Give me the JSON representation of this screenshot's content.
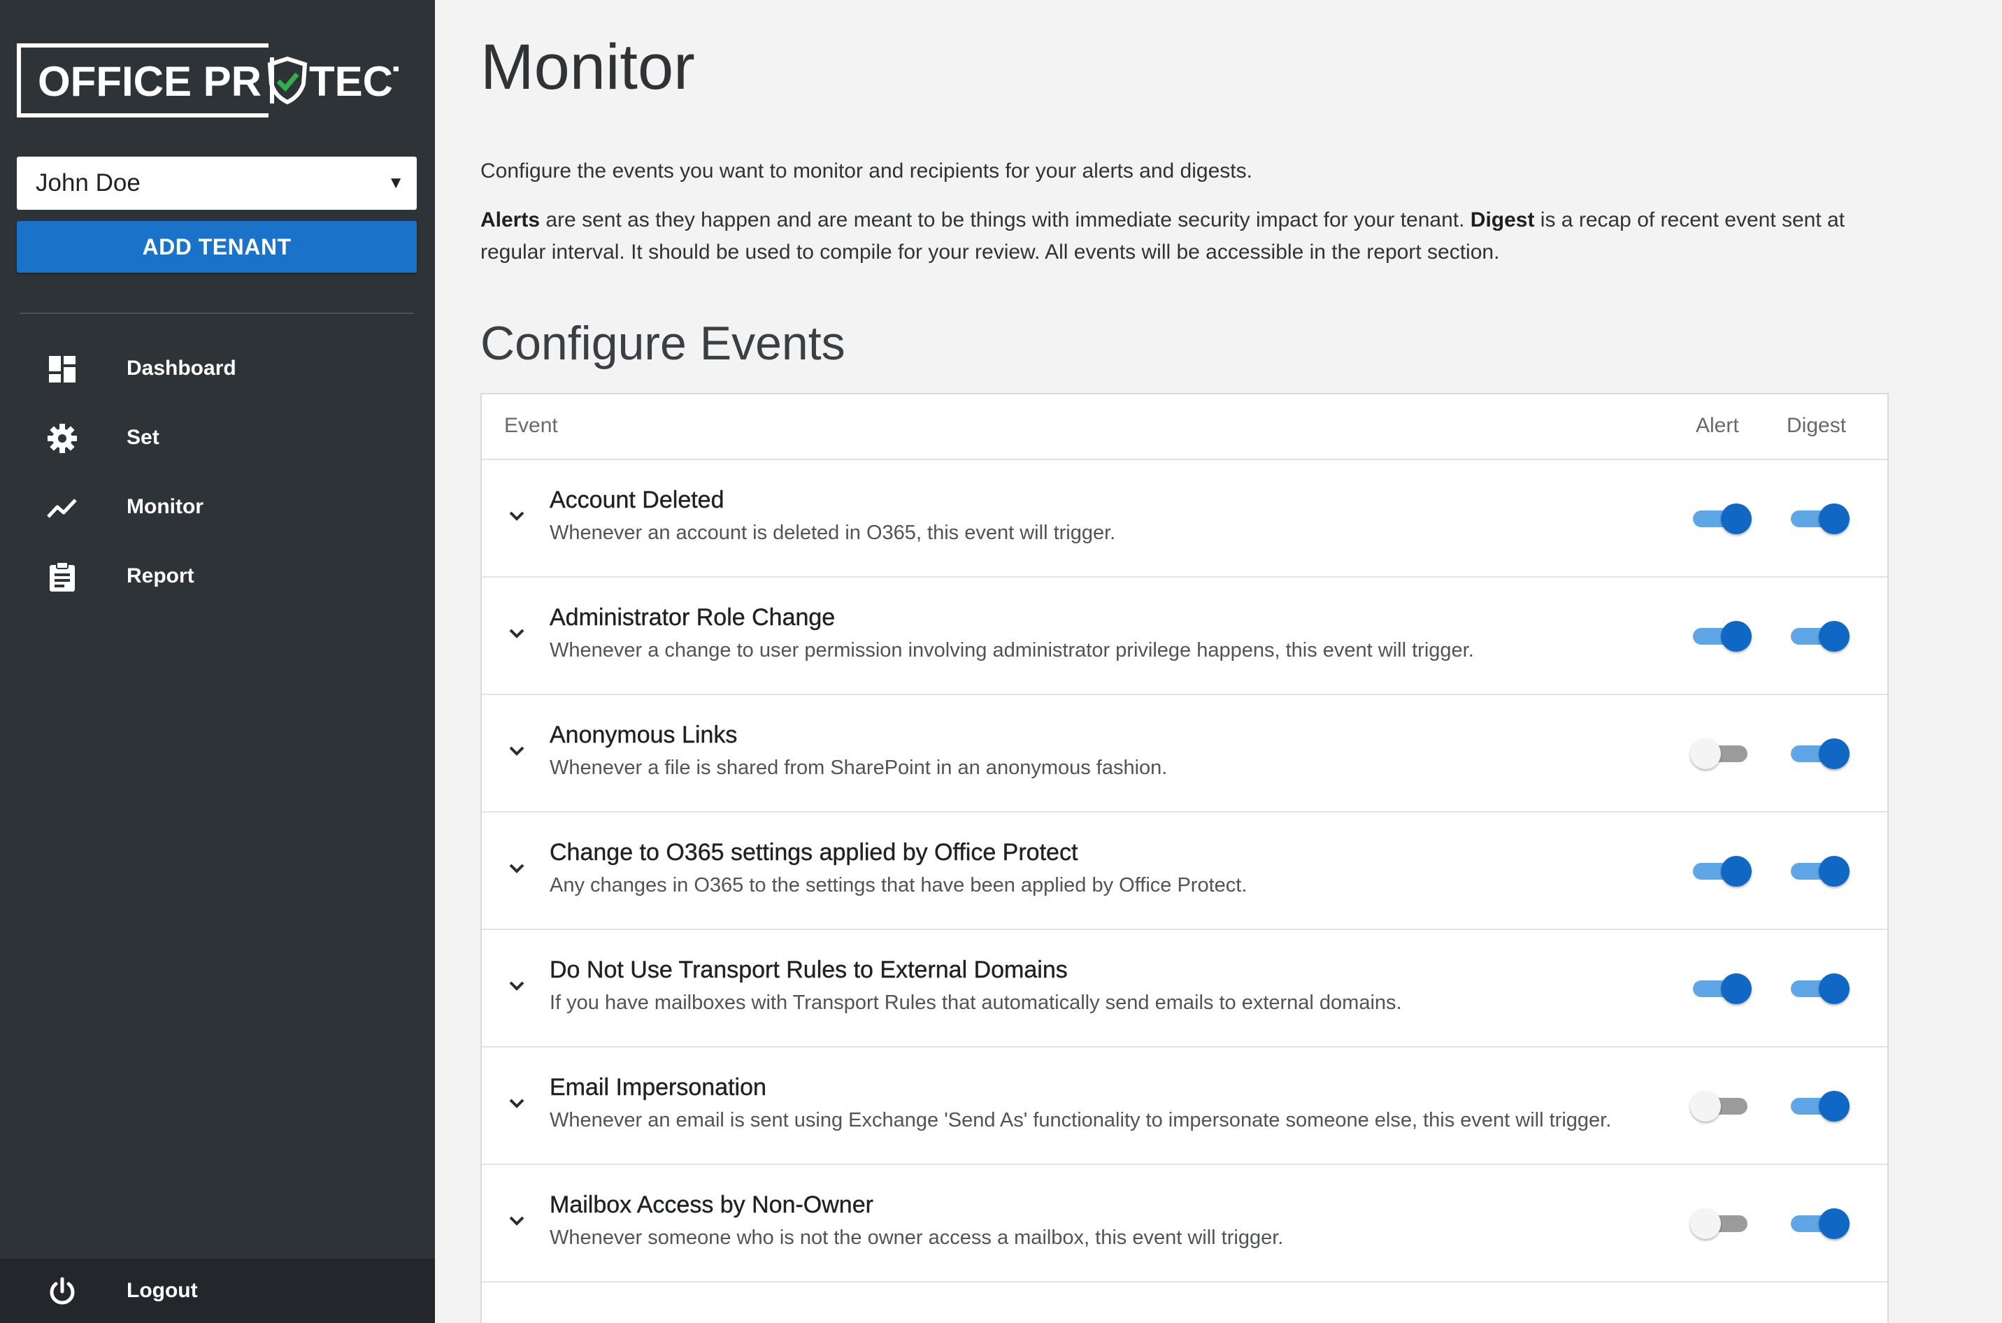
{
  "sidebar": {
    "logo_text_left": "OFFICE PR",
    "logo_text_right": "TECT",
    "tenant": {
      "selected": "John Doe"
    },
    "add_tenant_label": "ADD TENANT",
    "nav": [
      {
        "label": "Dashboard",
        "icon": "dashboard-icon"
      },
      {
        "label": "Set",
        "icon": "gear-icon"
      },
      {
        "label": "Monitor",
        "icon": "trend-line-icon"
      },
      {
        "label": "Report",
        "icon": "clipboard-icon"
      }
    ],
    "logout_label": "Logout"
  },
  "main": {
    "title": "Monitor",
    "intro": "Configure the events you want to monitor and recipients for your alerts and digests.",
    "alerts_term": "Alerts",
    "alerts_desc": " are sent as they happen and are meant to be things with immediate security impact for your tenant. ",
    "digest_term": "Digest",
    "digest_desc": " is a recap of recent event sent at regular interval. It should be used to compile for your review. All events will be accessible in the report section.",
    "section_title": "Configure Events",
    "columns": {
      "event": "Event",
      "alert": "Alert",
      "digest": "Digest"
    },
    "events": [
      {
        "title": "Account Deleted",
        "description": "Whenever an account is deleted in O365, this event will trigger.",
        "alert": true,
        "digest": true
      },
      {
        "title": "Administrator Role Change",
        "description": "Whenever a change to user permission involving administrator privilege happens, this event will trigger.",
        "alert": true,
        "digest": true
      },
      {
        "title": "Anonymous Links",
        "description": "Whenever a file is shared from SharePoint in an anonymous fashion.",
        "alert": false,
        "digest": true
      },
      {
        "title": "Change to O365 settings applied by Office Protect",
        "description": "Any changes in O365 to the settings that have been applied by Office Protect.",
        "alert": true,
        "digest": true
      },
      {
        "title": "Do Not Use Transport Rules to External Domains",
        "description": "If you have mailboxes with Transport Rules that automatically send emails to external domains.",
        "alert": true,
        "digest": true
      },
      {
        "title": "Email Impersonation",
        "description": "Whenever an email is sent using Exchange 'Send As' functionality to impersonate someone else, this event will trigger.",
        "alert": false,
        "digest": true
      },
      {
        "title": "Mailbox Access by Non-Owner",
        "description": "Whenever someone who is not the owner access a mailbox, this event will trigger.",
        "alert": false,
        "digest": true
      }
    ]
  },
  "colors": {
    "sidebar_bg": "#2e3338",
    "accent": "#1a73c9",
    "toggle_on": "#1068c4",
    "logo_check": "#2fb04a"
  }
}
